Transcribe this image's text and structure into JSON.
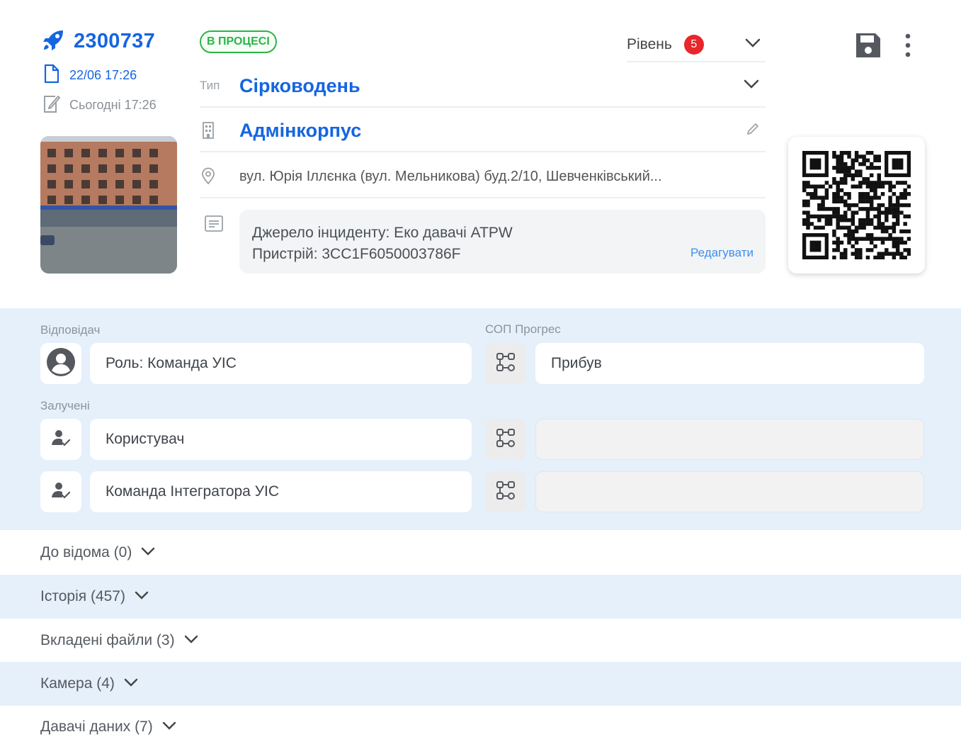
{
  "incident": {
    "id": "2300737",
    "created": "22/06 17:26",
    "edited": "Сьогодні 17:26",
    "status": "В ПРОЦЕСІ",
    "level_label": "Рівень",
    "level_value": "5",
    "type_label": "Тип",
    "type_value": "Сірководень",
    "object_value": "Адмінкорпус",
    "address": "вул. Юрія Іллєнка (вул. Мельникова) буд.2/10, Шевченківський...",
    "description_line1": "Джерело інциденту: Еко давачі ATPW",
    "description_line2": "Пристрій: 3CC1F6050003786F",
    "edit_label": "Редагувати"
  },
  "assignment": {
    "responsible_label": "Відповідач",
    "responsible_value": "Роль: Команда УІС",
    "sop_label": "СОП Прогрес",
    "sop_value": "Прибув",
    "involved_label": "Залучені",
    "involved": [
      {
        "name": "Користувач",
        "sop": ""
      },
      {
        "name": "Команда Інтегратора УІС",
        "sop": ""
      }
    ]
  },
  "sections": [
    {
      "label": "До відома (0)"
    },
    {
      "label": "Історія (457)"
    },
    {
      "label": "Вкладені файли (3)"
    },
    {
      "label": "Камера (4)"
    },
    {
      "label": "Давачі даних (7)"
    }
  ],
  "colors": {
    "primary": "#1565e0",
    "status_green": "#2db24a",
    "level_red": "#e8262b",
    "section_blue": "#e5f0fb",
    "link": "#3d8ff0"
  },
  "icons": {
    "id": "rocket-icon",
    "created": "document-icon",
    "edited": "edit-note-icon",
    "object": "building-icon",
    "address": "location-pin-icon",
    "description": "description-icon",
    "save": "save-icon",
    "menu": "more-vertical-icon",
    "responsible": "account-circle-icon",
    "involved": "person-check-icon",
    "sop": "sop-flow-icon"
  }
}
